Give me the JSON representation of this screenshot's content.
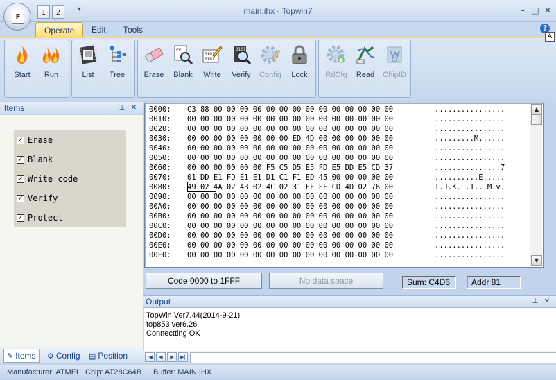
{
  "window": {
    "title": "main.ihx - Topwin7",
    "orb_letter": "F",
    "quick_access": [
      "1",
      "2"
    ],
    "quick_access_menu": "▾",
    "controls": {
      "minimize": "–",
      "maximize": "□",
      "close": "✕"
    }
  },
  "menu_tabs": [
    "Operate",
    "Edit",
    "Tools"
  ],
  "active_tab": "Operate",
  "help": {
    "icon": "?",
    "a_box": "A"
  },
  "ribbon": {
    "groups": [
      {
        "buttons": [
          {
            "label": "Start",
            "icon": "flame-icon"
          },
          {
            "label": "Run",
            "icon": "double-flame-icon"
          }
        ]
      },
      {
        "buttons": [
          {
            "label": "List",
            "icon": "list-chip-icon"
          },
          {
            "label": "Tree",
            "icon": "tree-icon"
          }
        ]
      },
      {
        "buttons": [
          {
            "label": "Erase",
            "icon": "eraser-icon"
          },
          {
            "label": "Blank",
            "icon": "blank-check-icon"
          },
          {
            "label": "Write",
            "icon": "write-pencil-icon"
          },
          {
            "label": "Verify",
            "icon": "verify-magnifier-icon"
          },
          {
            "label": "Config",
            "icon": "config-gear-icon",
            "disabled": true
          },
          {
            "label": "Lock",
            "icon": "padlock-icon"
          }
        ]
      },
      {
        "buttons": [
          {
            "label": "RdCfg",
            "icon": "read-config-gear-icon",
            "disabled": true
          },
          {
            "label": "Read",
            "icon": "read-arrow-icon"
          },
          {
            "label": "ChipID",
            "icon": "chip-id-icon",
            "disabled": true
          }
        ]
      }
    ],
    "icon_glyphs": {
      "Write": "0101",
      "Verify": "0101",
      "Blank": "FF"
    }
  },
  "items_panel": {
    "title": "Items",
    "pin": "⊥",
    "close": "✕",
    "items": [
      {
        "label": "Erase",
        "checked": true
      },
      {
        "label": "Blank",
        "checked": true
      },
      {
        "label": "Write code",
        "checked": true
      },
      {
        "label": "Verify",
        "checked": true
      },
      {
        "label": "Protect",
        "checked": true
      }
    ],
    "check_mark": "✓",
    "tabs": [
      {
        "label": "Items",
        "icon": "items-tab-icon",
        "glyph": "✎"
      },
      {
        "label": "Config",
        "icon": "config-tab-icon",
        "glyph": "⚙"
      },
      {
        "label": "Position",
        "icon": "position-tab-icon",
        "glyph": "▤"
      }
    ]
  },
  "hex": {
    "lines": [
      {
        "addr": "0000:",
        "bytes": "C3 88 00 00 00 00 00 00 00 00 00 00 00 00 00 00",
        "ascii": "................"
      },
      {
        "addr": "0010:",
        "bytes": "00 00 00 00 00 00 00 00 00 00 00 00 00 00 00 00",
        "ascii": "................"
      },
      {
        "addr": "0020:",
        "bytes": "00 00 00 00 00 00 00 00 00 00 00 00 00 00 00 00",
        "ascii": "................"
      },
      {
        "addr": "0030:",
        "bytes": "00 00 00 00 00 00 00 00 ED 4D 00 00 00 00 00 00",
        "ascii": ".........M......"
      },
      {
        "addr": "0040:",
        "bytes": "00 00 00 00 00 00 00 00 00 00 00 00 00 00 00 00",
        "ascii": "................"
      },
      {
        "addr": "0050:",
        "bytes": "00 00 00 00 00 00 00 00 00 00 00 00 00 00 00 00",
        "ascii": "................"
      },
      {
        "addr": "0060:",
        "bytes": "00 00 00 00 00 00 F5 C5 D5 E5 FD E5 DD E5 CD 37",
        "ascii": "...............7"
      },
      {
        "addr": "0070:",
        "bytes": "01 DD E1 FD E1 E1 D1 C1 F1 ED 45 00 00 00 00 00",
        "ascii": "..........E....."
      },
      {
        "addr": "0080:",
        "bytes": "49 02 4A 02 4B 02 4C 02 31 FF FF CD 4D 02 76 00",
        "ascii": "I.J.K.L.1...M.v."
      },
      {
        "addr": "0090:",
        "bytes": "00 00 00 00 00 00 00 00 00 00 00 00 00 00 00 00",
        "ascii": "................"
      },
      {
        "addr": "00A0:",
        "bytes": "00 00 00 00 00 00 00 00 00 00 00 00 00 00 00 00",
        "ascii": "................"
      },
      {
        "addr": "00B0:",
        "bytes": "00 00 00 00 00 00 00 00 00 00 00 00 00 00 00 00",
        "ascii": "................"
      },
      {
        "addr": "00C0:",
        "bytes": "00 00 00 00 00 00 00 00 00 00 00 00 00 00 00 00",
        "ascii": "................"
      },
      {
        "addr": "00D0:",
        "bytes": "00 00 00 00 00 00 00 00 00 00 00 00 00 00 00 00",
        "ascii": "................"
      },
      {
        "addr": "00E0:",
        "bytes": "00 00 00 00 00 00 00 00 00 00 00 00 00 00 00 00",
        "ascii": "................"
      },
      {
        "addr": "00F0:",
        "bytes": "00 00 00 00 00 00 00 00 00 00 00 00 00 00 00 00",
        "ascii": "................"
      }
    ],
    "scroll_up": "▲",
    "scroll_down": "▼"
  },
  "info_bar": {
    "code_range": "Code 0000 to 1FFF",
    "data_space": "No data space",
    "sum": "Sum: C4D6",
    "addr": "Addr 81"
  },
  "output": {
    "title": "Output",
    "pin": "⊥",
    "close": "✕",
    "lines": [
      "TopWin Ver7.44(2014-9-21)",
      "top853 ver6.26",
      "Connectting OK"
    ],
    "nav": [
      "|◀",
      "◀",
      "▶",
      "▶|"
    ]
  },
  "status": {
    "manufacturer": "Manufacturer: ATMEL",
    "chip": "Chip: AT28C64B",
    "buffer": "Buffer: MAIN.IHX"
  }
}
